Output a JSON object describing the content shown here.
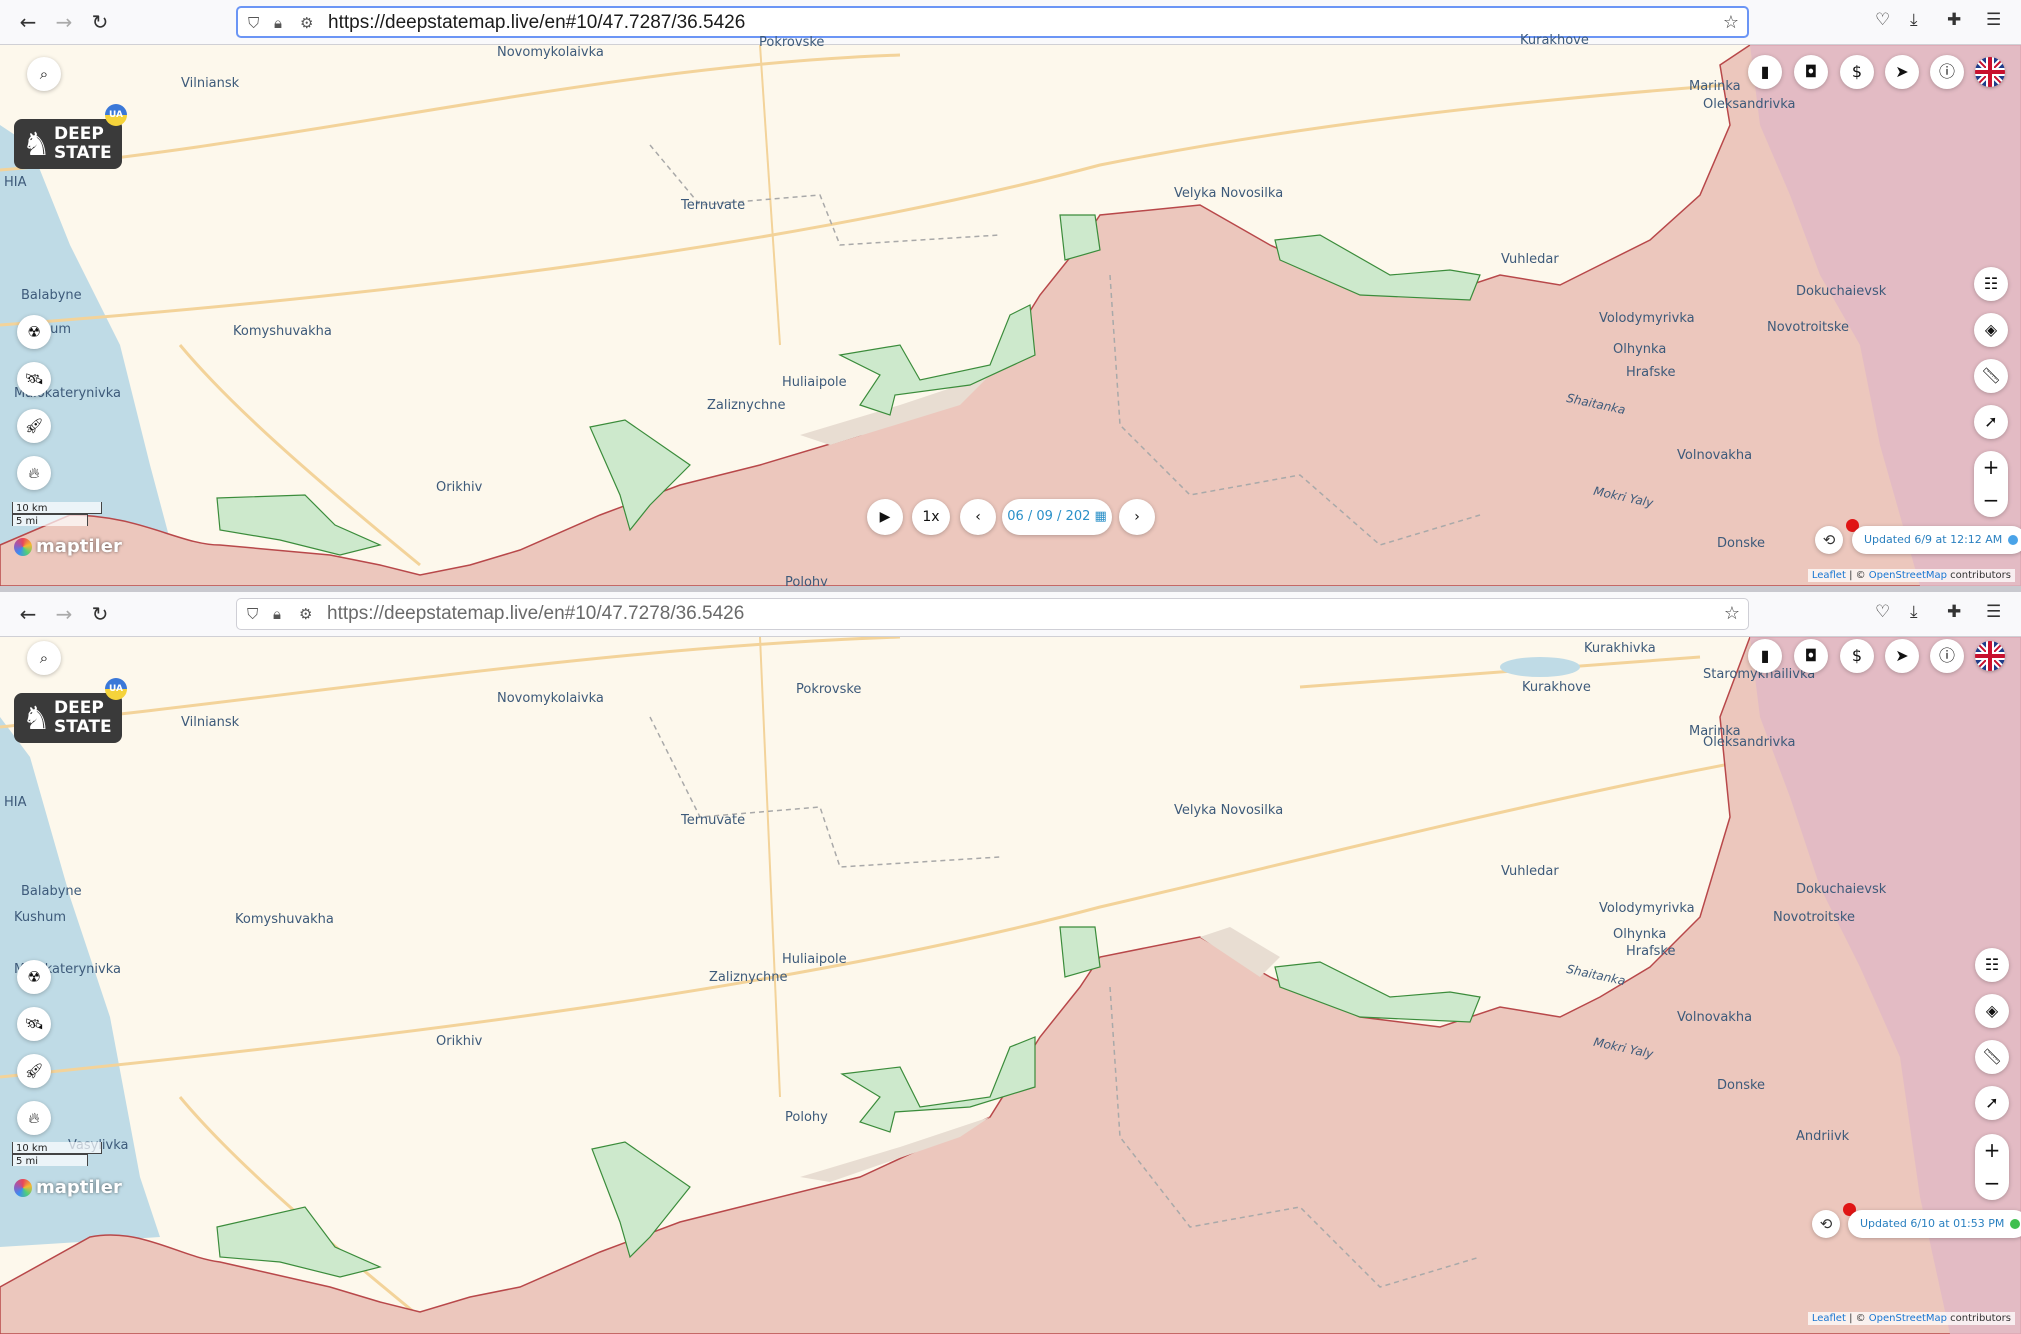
{
  "windows": [
    {
      "url_host": "https://deepstatemap.live",
      "url_path": "/en#10/47.7287/36.5426",
      "places": {
        "novomykolaivka": "Novomykolaivka",
        "pokrovske": "Pokrovske",
        "kurakhove": "Kurakhove",
        "vilniansk": "Vilniansk",
        "hia": "HIA",
        "ternuvate": "Ternuvate",
        "velyka_novosilka": "Velyka Novosilka",
        "vuhledar": "Vuhledar",
        "marinka": "Marinka",
        "oleksandrivka": "Oleksandrivka",
        "balabyne": "Balabyne",
        "kushum": "Kushum",
        "komyshuvakha": "Komyshuvakha",
        "malokaterynivka": "Malokaterynivka",
        "huliaipole": "Huliaipole",
        "zaliznychne": "Zaliznychne",
        "orikhiv": "Orikhiv",
        "volodymyrivka": "Volodymyrivka",
        "olhynka": "Olhynka",
        "novotroitske": "Novotroitske",
        "dokuchaievsk": "Dokuchaievsk",
        "hrafske": "Hrafske",
        "volnovakha": "Volnovakha",
        "donske": "Donske",
        "polohy": "Polohy"
      },
      "rivers": {
        "shaitanka": "Shaitanka",
        "mokri_yaly": "Mokri Yaly"
      },
      "logo": {
        "line1": "DEEP",
        "line2": "STATE",
        "badge": "UA"
      },
      "scale": {
        "km": "10 km",
        "mi": "5 mi"
      },
      "maptiler": "maptiler",
      "attribution": {
        "leaflet": "Leaflet",
        "sep": " | © ",
        "osm": "OpenStreetMap",
        "contrib": " contributors"
      },
      "updated": "Updated 6/9 at 12:12 AM",
      "status_color": "#4aa3e8",
      "player": {
        "speed": "1x",
        "date": "06 / 09 / 202"
      }
    },
    {
      "url_host": "https://deepstatemap.live",
      "url_path": "/en#10/47.7278/36.5426",
      "places": {
        "novomykolaivka": "Novomykolaivka",
        "pokrovske": "Pokrovske",
        "kurakhivka": "Kurakhivka",
        "kurakhove": "Kurakhove",
        "staromykhailivka": "Staromykhailivka",
        "vilniansk": "Vilniansk",
        "hia": "HIA",
        "ternuvate": "Ternuvate",
        "velyka_novosilka": "Velyka Novosilka",
        "vuhledar": "Vuhledar",
        "marinka": "Marinka",
        "oleksandrivka": "Oleksandrivka",
        "balabyne": "Balabyne",
        "kushum": "Kushum",
        "komyshuvakha": "Komyshuvakha",
        "malokaterynivka": "Malokaterynivka",
        "huliaipole": "Huliaipole",
        "zaliznychne": "Zaliznychne",
        "orikhiv": "Orikhiv",
        "volodymyrivka": "Volodymyrivka",
        "olhynka": "Olhynka",
        "novotroitske": "Novotroitske",
        "dokuchaievsk": "Dokuchaievsk",
        "hrafske": "Hrafske",
        "volnovakha": "Volnovakha",
        "donske": "Donske",
        "polohy": "Polohy",
        "andriivka": "Andriivk",
        "vasylivka": "Vasylivka"
      },
      "rivers": {
        "shaitanka": "Shaitanka",
        "mokri_yaly": "Mokri Yaly"
      },
      "logo": {
        "line1": "DEEP",
        "line2": "STATE",
        "badge": "UA"
      },
      "scale": {
        "km": "10 km",
        "mi": "5 mi"
      },
      "maptiler": "maptiler",
      "attribution": {
        "leaflet": "Leaflet",
        "sep": " | © ",
        "osm": "OpenStreetMap",
        "contrib": " contributors"
      },
      "updated": "Updated 6/10 at 01:53 PM",
      "status_color": "#3fbf4f"
    }
  ],
  "colors": {
    "occupied": "#ecc7bd",
    "liberated": "#cde9cc",
    "contested": "#e8ddd2",
    "dnr": "#e2b8c6",
    "land": "#fdf8ec",
    "sea": "#bfdbe6"
  }
}
